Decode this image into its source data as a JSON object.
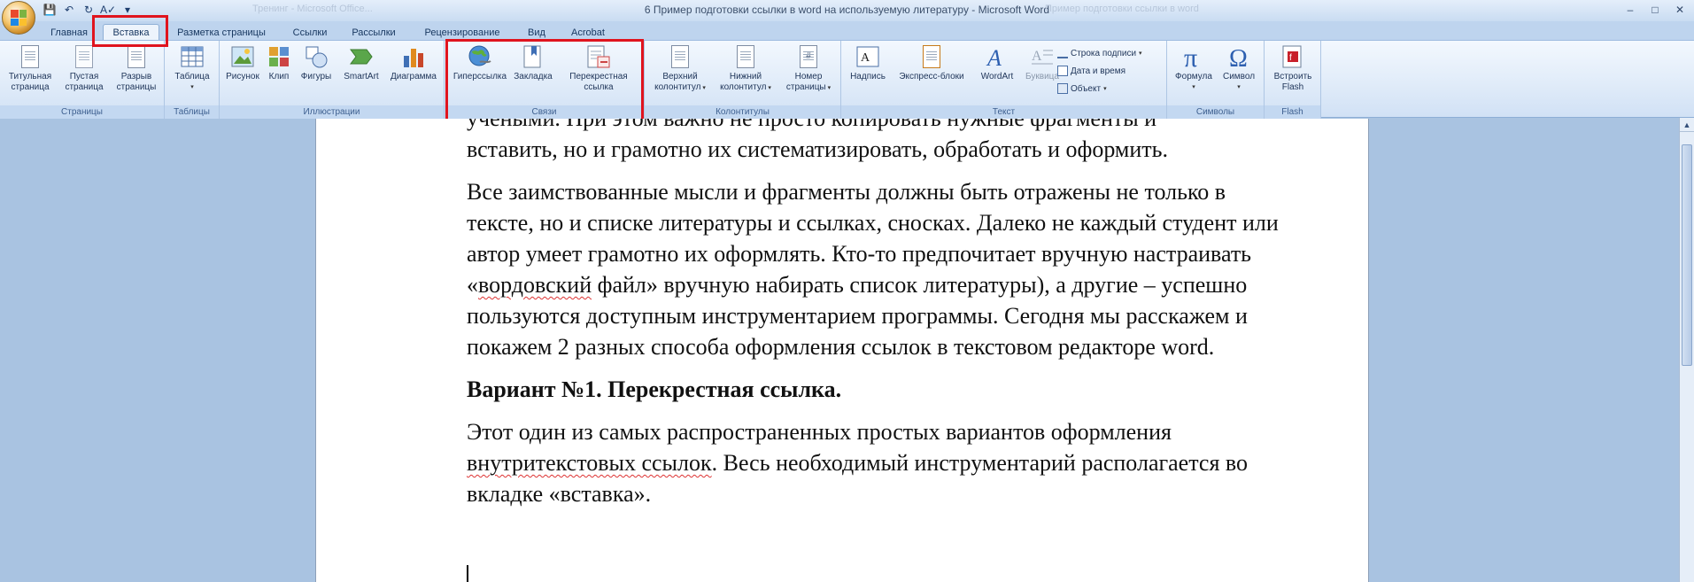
{
  "window": {
    "title": "6 Пример подготовки ссылки в word на используемую литературу - Microsoft Word",
    "ghost_left": "Тренинг - Microsoft Office...",
    "ghost_right": "Пример подготовки ссылки в word"
  },
  "quick_access": {
    "icons": [
      "save-icon",
      "undo-icon",
      "redo-icon",
      "spelling-icon",
      "customize-icon"
    ]
  },
  "window_buttons": {
    "minimize": "–",
    "maximize": "□",
    "close": "✕"
  },
  "tabs": [
    {
      "label": "Главная"
    },
    {
      "label": "Вставка",
      "active": true
    },
    {
      "label": "Разметка страницы"
    },
    {
      "label": "Ссылки"
    },
    {
      "label": "Рассылки"
    },
    {
      "label": "Рецензирование"
    },
    {
      "label": "Вид"
    },
    {
      "label": "Acrobat"
    }
  ],
  "ribbon": {
    "groups": {
      "pages": "Страницы",
      "tables": "Таблицы",
      "illustrations": "Иллюстрации",
      "links": "Связи",
      "header_footer": "Колонтитулы",
      "text": "Текст",
      "symbols": "Символы",
      "flash": "Flash"
    },
    "buttons": {
      "cover_page": [
        "Титульная",
        "страница"
      ],
      "blank_page": [
        "Пустая",
        "страница"
      ],
      "page_break": [
        "Разрыв",
        "страницы"
      ],
      "table": [
        "Таблица",
        ""
      ],
      "picture": [
        "Рисунок",
        ""
      ],
      "clip": [
        "Клип",
        ""
      ],
      "shapes": [
        "Фигуры",
        ""
      ],
      "smartart": [
        "SmartArt",
        ""
      ],
      "chart": [
        "Диаграмма",
        ""
      ],
      "hyperlink": [
        "Гиперссылка",
        ""
      ],
      "bookmark": [
        "Закладка",
        ""
      ],
      "cross_reference": [
        "Перекрестная",
        "ссылка"
      ],
      "header": [
        "Верхний",
        "колонтитул"
      ],
      "footer": [
        "Нижний",
        "колонтитул"
      ],
      "page_number": [
        "Номер",
        "страницы"
      ],
      "text_box": [
        "Надпись",
        ""
      ],
      "quick_parts": [
        "Экспресс-блоки",
        ""
      ],
      "wordart": [
        "WordArt",
        ""
      ],
      "drop_cap": [
        "Буквица",
        ""
      ],
      "equation": [
        "Формула",
        ""
      ],
      "symbol": [
        "Символ",
        ""
      ],
      "insert_flash": [
        "Встроить",
        "Flash"
      ]
    },
    "small_buttons": {
      "signature_line": "Строка подписи",
      "date_time": "Дата и время",
      "object": "Объект"
    }
  },
  "document": {
    "p1a": "учеными. При этом важно не просто копировать нужные фрагменты и",
    "p1b": "вставить, но и грамотно их систематизировать, обработать и оформить.",
    "p2a": "Все заимствованные мысли и фрагменты должны быть отражены не только в тексте, но и списке литературы и ссылках, сносках. Далеко не каждый студент или автор умеет грамотно их оформлять. Кто-то предпочитает вручную настраивать «",
    "p2_sq": "вордовский",
    "p2b": " файл» вручную набирать список литературы), а другие – успешно пользуются доступным инструментарием программы. Сегодня мы расскажем и покажем 2 разных способа оформления ссылок в текстовом редакторе word.",
    "heading": "Вариант №1. Перекрестная ссылка.",
    "p3a": "Этот один из самых распространенных  простых вариантов оформления ",
    "p3_sq": "внутритекстовых ссылок",
    "p3b": ". Весь необходимый инструментарий располагается во вкладке «вставка»."
  }
}
